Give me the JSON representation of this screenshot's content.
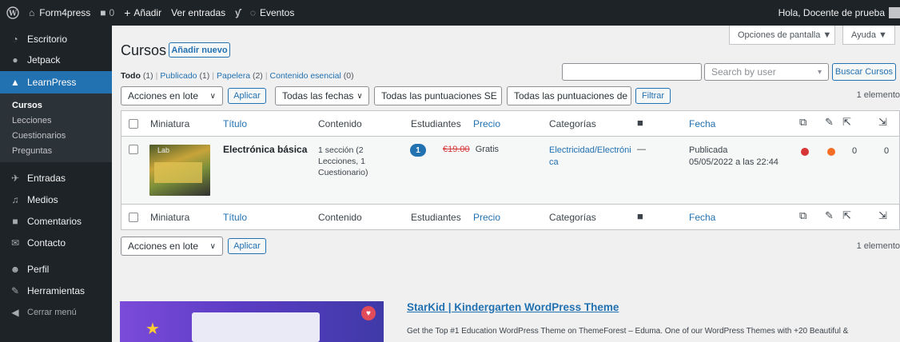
{
  "adminbar": {
    "site_name": "Form4press",
    "comments_count": "0",
    "new_label": "Añadir",
    "view_entries": "Ver entradas",
    "events": "Eventos",
    "greeting": "Hola, Docente de prueba"
  },
  "sidebar": {
    "items": [
      {
        "label": "Escritorio",
        "icon": "dashboard-icon"
      },
      {
        "label": "Jetpack",
        "icon": "jetpack-icon"
      },
      {
        "label": "LearnPress",
        "icon": "learnpress-icon"
      }
    ],
    "submenu": [
      "Cursos",
      "Lecciones",
      "Cuestionarios",
      "Preguntas"
    ],
    "items2": [
      {
        "label": "Entradas",
        "icon": "pin-icon"
      },
      {
        "label": "Medios",
        "icon": "media-icon"
      },
      {
        "label": "Comentarios",
        "icon": "comment-icon"
      },
      {
        "label": "Contacto",
        "icon": "mail-icon"
      },
      {
        "label": "Perfil",
        "icon": "user-icon"
      },
      {
        "label": "Herramientas",
        "icon": "wrench-icon"
      },
      {
        "label": "Cerrar menú",
        "icon": "collapse-icon"
      }
    ]
  },
  "screen_meta": {
    "options": "Opciones de pantalla ▼",
    "help": "Ayuda ▼"
  },
  "page": {
    "title": "Cursos",
    "add_new": "Añadir nuevo"
  },
  "views": {
    "all": "Todo",
    "all_count": "(1)",
    "published": "Publicado",
    "published_count": "(1)",
    "trash": "Papelera",
    "trash_count": "(2)",
    "essential": "Contenido esencial",
    "essential_count": "(0)"
  },
  "search": {
    "placeholder": "Search by user",
    "button": "Buscar Cursos"
  },
  "tablenav_top": {
    "bulk": "Acciones en lote",
    "apply": "Aplicar",
    "dates": "Todas las fechas",
    "seo_scores": "Todas las puntuaciones SE",
    "readability": "Todas las puntuaciones de",
    "filter": "Filtrar",
    "items": "1 elemento"
  },
  "tablenav_bottom": {
    "bulk": "Acciones en lote",
    "apply": "Aplicar",
    "items": "1 elemento"
  },
  "table": {
    "columns": {
      "thumbnail": "Miniatura",
      "title": "Título",
      "content": "Contenido",
      "students": "Estudiantes",
      "price": "Precio",
      "categories": "Categorías",
      "date": "Fecha"
    },
    "row": {
      "thumb_label": "Lab",
      "title": "Electrónica básica",
      "content_1": "1 sección (2",
      "content_2": "Lecciones, 1",
      "content_3": "Cuestionario)",
      "students": "1",
      "old_price": "€19.00",
      "price": "Gratis",
      "category_1": "Electricidad/Electróni",
      "category_2": "ca",
      "comments": "—",
      "status": "Publicada",
      "date": "05/05/2022 a las 22:44",
      "links_out": "0",
      "links_in": "0",
      "seo_color": "#d63638",
      "readability_color": "#f56e28"
    }
  },
  "promo": {
    "title": "StarKid | Kindergarten WordPress Theme",
    "text": "Get the Top #1 Education WordPress Theme on ThemeForest – Eduma. One of our WordPress Themes with +20 Beautiful &"
  }
}
